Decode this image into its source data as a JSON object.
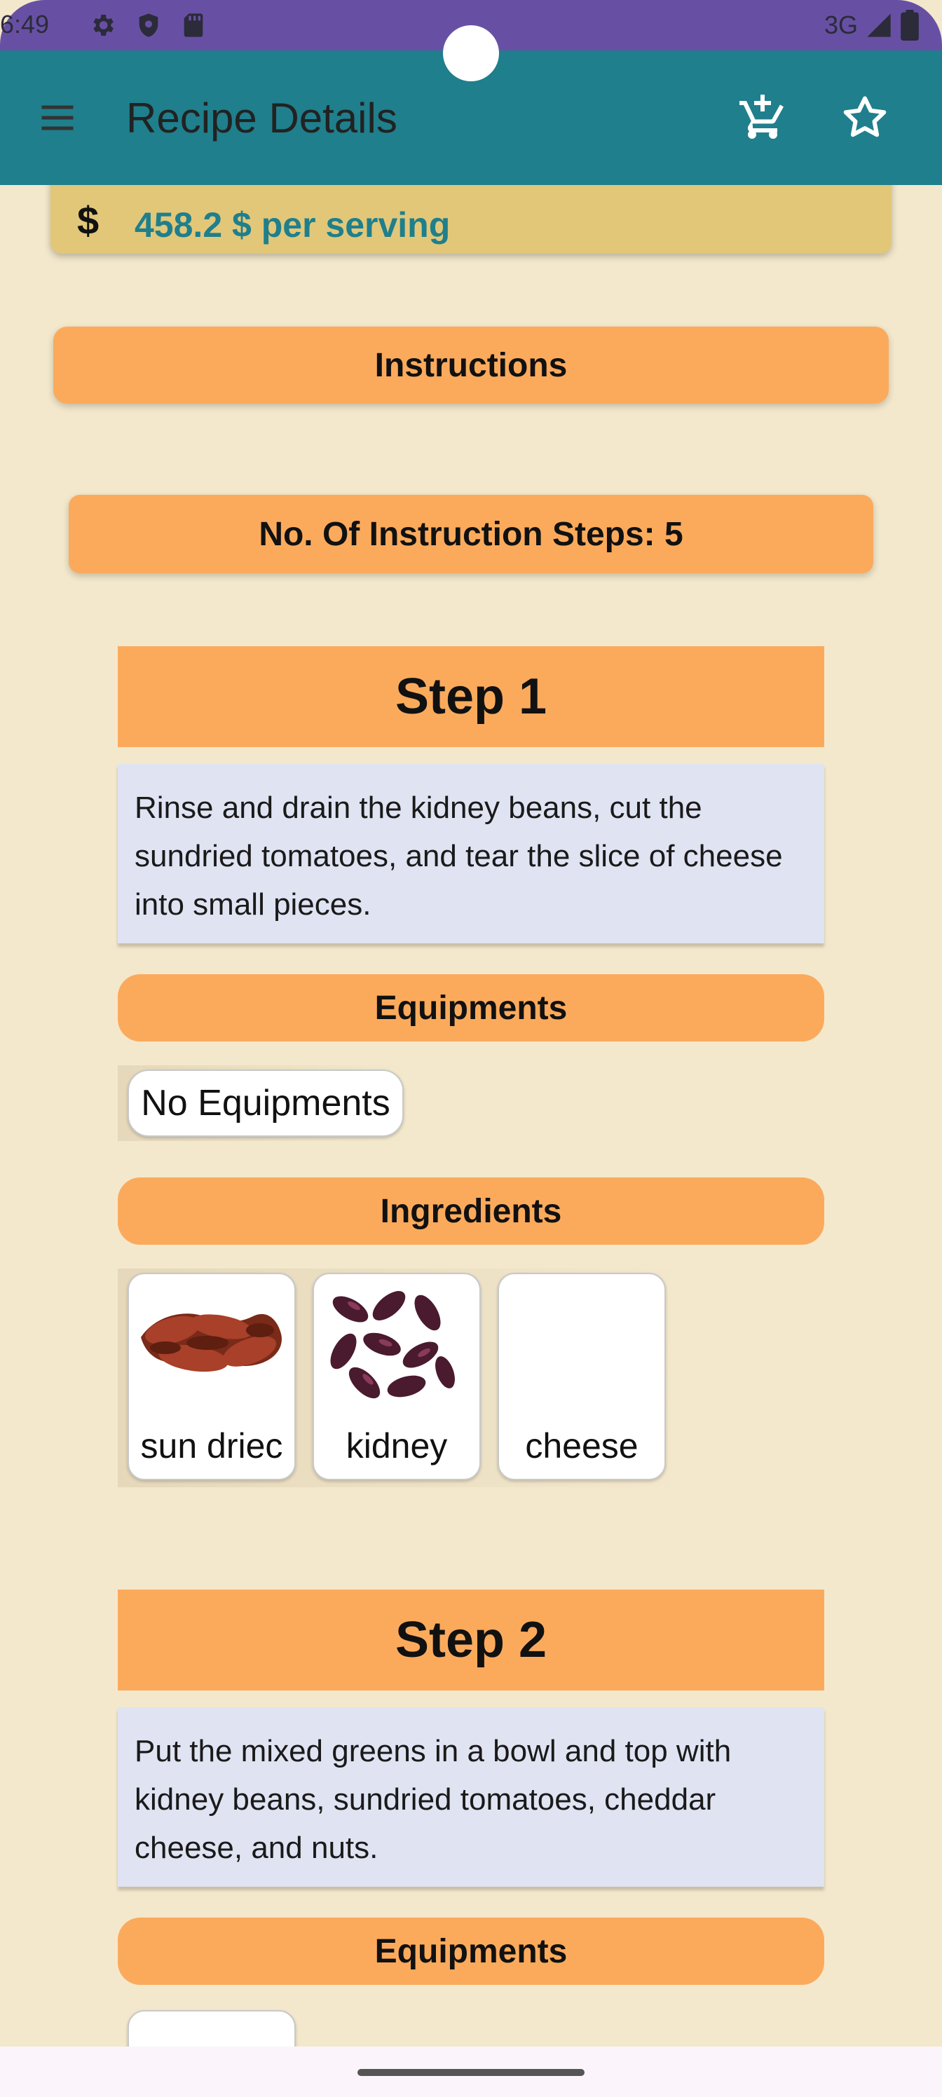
{
  "status_bar": {
    "time": "6:49",
    "network": "3G"
  },
  "app_bar": {
    "title": "Recipe Details",
    "icons": [
      "menu-icon",
      "add-to-cart-icon",
      "star-outline-icon"
    ]
  },
  "price": {
    "symbol": "$",
    "text": "458.2 $ per serving"
  },
  "instructions_heading": "Instructions",
  "steps_count_label": "No. Of Instruction Steps: 5",
  "steps": [
    {
      "title": "Step 1",
      "text": "Rinse and drain the kidney beans, cut the sundried tomatoes, and tear the slice of cheese into small pieces.",
      "equipments_label": "Equipments",
      "equipments_empty": "No Equipments",
      "ingredients_label": "Ingredients",
      "ingredients": [
        "sun driec",
        "kidney",
        "cheese"
      ]
    },
    {
      "title": "Step 2",
      "text": "Put the mixed greens in a bowl and top with kidney beans, sundried tomatoes, cheddar cheese, and nuts.",
      "equipments_label": "Equipments"
    }
  ],
  "colors": {
    "status_bar": "#6750a4",
    "app_bar": "#1f7f8c",
    "background": "#f3e8cc",
    "accent": "#fbaa5c",
    "price_card": "#e2c779",
    "step_text_bg": "#e0e3f2"
  }
}
